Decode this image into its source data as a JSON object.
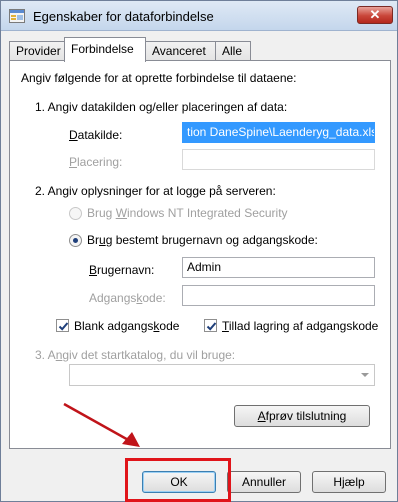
{
  "window": {
    "title": "Egenskaber for dataforbindelse",
    "close_glyph": "✕"
  },
  "tabs": [
    "Provider",
    "Forbindelse",
    "Avanceret",
    "Alle"
  ],
  "active_tab": "Forbindelse",
  "intro": "Angiv følgende for at oprette forbindelse til dataene:",
  "step1": {
    "heading": "1. Angiv datakilden og/eller placeringen af data:",
    "datasource_label_u": "D",
    "datasource_label_rest": "atakilde:",
    "datasource_value": "tion DaneSpine\\Laenderyg_data.xlsx",
    "location_label_u": "P",
    "location_label_rest": "lacering:",
    "location_value": ""
  },
  "step2": {
    "heading": "2. Angiv oplysninger for at logge på serveren:",
    "radio_windows_pre": "Brug ",
    "radio_windows_u": "W",
    "radio_windows_post": "indows NT Integrated Security",
    "radio_specific_pre": "Br",
    "radio_specific_u": "u",
    "radio_specific_post": "g bestemt brugernavn og adgangskode:",
    "username_label_u": "B",
    "username_label_rest": "rugernavn:",
    "username_value": "Admin",
    "password_label_pre": "Adgangs",
    "password_label_u": "k",
    "password_label_post": "ode:",
    "password_value": "",
    "blank_pw_pre": "Blank adgangs",
    "blank_pw_u": "k",
    "blank_pw_post": "ode",
    "blank_pw_checked": true,
    "allow_save_u": "T",
    "allow_save_rest": "illad lagring af adgangskode",
    "allow_save_checked": true,
    "selected_auth": "specific"
  },
  "step3": {
    "heading_pre": "3. A",
    "heading_u": "n",
    "heading_post": "giv det startkatalog, du vil bruge:",
    "catalog_value": ""
  },
  "test_button_u": "A",
  "test_button_rest": "fprøv tilslutning",
  "footer": {
    "ok": "OK",
    "cancel": "Annuller",
    "help": "Hjælp"
  },
  "colors": {
    "highlight": "#e0141a",
    "selection": "#3399ff"
  }
}
